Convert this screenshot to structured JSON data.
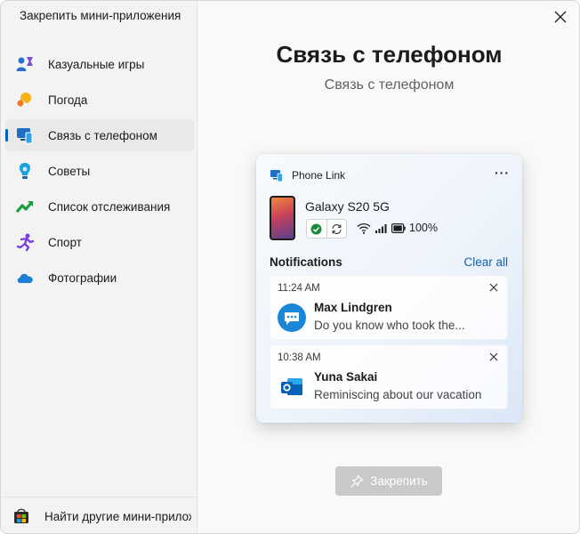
{
  "sidebar": {
    "title": "Закрепить мини-приложения",
    "items": [
      {
        "label": "Казуальные игры",
        "icon": "casual-games-icon"
      },
      {
        "label": "Погода",
        "icon": "weather-icon"
      },
      {
        "label": "Связь с телефоном",
        "icon": "phone-link-icon",
        "selected": true
      },
      {
        "label": "Советы",
        "icon": "tips-icon"
      },
      {
        "label": "Список отслеживания",
        "icon": "watchlist-icon"
      },
      {
        "label": "Спорт",
        "icon": "sports-icon"
      },
      {
        "label": "Фотографии",
        "icon": "photos-icon"
      }
    ],
    "footer": {
      "label": "Найти другие мини-приложения",
      "icon": "store-icon"
    }
  },
  "main": {
    "title": "Связь с телефоном",
    "subtitle": "Связь с телефоном",
    "pin_button": "Закрепить"
  },
  "widget": {
    "app_name": "Phone Link",
    "more": "···",
    "device_name": "Galaxy S20 5G",
    "battery": "100%",
    "notifications_heading": "Notifications",
    "clear_all": "Clear all",
    "notifications": [
      {
        "time": "11:24 AM",
        "sender": "Max Lindgren",
        "message": "Do you know who took the...",
        "app_icon": "messages-icon"
      },
      {
        "time": "10:38 AM",
        "sender": "Yuna Sakai",
        "message": "Reminiscing about our vacation",
        "app_icon": "outlook-icon"
      }
    ]
  },
  "colors": {
    "accent": "#005fb8",
    "link": "#0f5fae",
    "pin_button_disabled": "#c9c9c9"
  }
}
